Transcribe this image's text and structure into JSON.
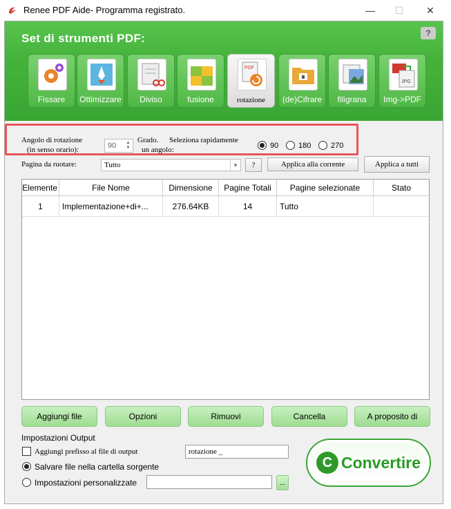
{
  "window": {
    "title": "Renee PDF Aide- Programma registrato.",
    "minimize": "—",
    "maximize": "☐",
    "close": "✕"
  },
  "header": {
    "title": "Set di strumenti PDF:",
    "help": "?",
    "tools": [
      {
        "label": "Fissare",
        "icon": "gears-icon"
      },
      {
        "label": "Ottimizzare",
        "icon": "rocket-icon"
      },
      {
        "label": "Diviso",
        "icon": "scissors-icon"
      },
      {
        "label": "fusione",
        "icon": "puzzle-icon"
      },
      {
        "label": "rotazione",
        "icon": "rotate-icon",
        "active": true
      },
      {
        "label": "(de)Cifrare",
        "icon": "folder-lock-icon"
      },
      {
        "label": "filigrana",
        "icon": "watermark-icon"
      },
      {
        "label": "Img->PDF",
        "icon": "image-to-pdf-icon"
      }
    ]
  },
  "rotation": {
    "angle_label_1": "Angolo di rotazione",
    "angle_label_2": "(in senso orario):",
    "angle_value": "90",
    "grade_label": "Grado.",
    "quick_label_1": "Seleziona rapidamente",
    "quick_label_2": "un angolo:",
    "options": [
      "90",
      "180",
      "270"
    ],
    "selected": "90"
  },
  "pages": {
    "label": "Pagina da ruotare:",
    "value": "Tutto",
    "help": "?",
    "apply_current": "Applica alla corrente",
    "apply_all": "Applica a tutti"
  },
  "table": {
    "columns": [
      "Elemente",
      "File Nome",
      "Dimensione",
      "Pagine Totali",
      "Pagine selezionate",
      "Stato"
    ],
    "rows": [
      [
        "1",
        "Implementazione+di+...",
        "276.64KB",
        "14",
        "Tutto",
        ""
      ]
    ]
  },
  "buttons": {
    "add": "Aggiungi file",
    "options": "Opzioni",
    "remove": "Rimuovi",
    "delete": "Cancella",
    "about": "A proposito di"
  },
  "output": {
    "title": "Impostazioni Output",
    "prefix_label": "Aggiungi prefisso al file di output",
    "prefix_value": "rotazione _",
    "prefix_checked": false,
    "save_source": "Salvare file nella cartella sorgente",
    "custom": "Impostazioni personalizzate",
    "custom_path": "",
    "browse": "...",
    "selected": "source"
  },
  "convert": {
    "label": "Convertire",
    "icon_glyph": "C"
  }
}
